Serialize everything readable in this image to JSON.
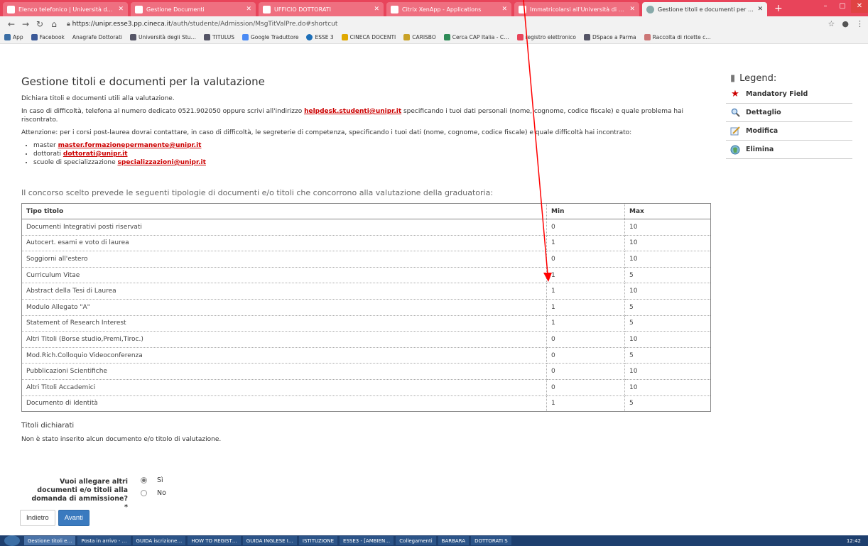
{
  "browser": {
    "tabs": [
      {
        "label": "Elenco telefonico | Università deg…"
      },
      {
        "label": "Gestione Documenti"
      },
      {
        "label": "UFFICIO DOTTORATI"
      },
      {
        "label": "Citrix XenApp - Applications"
      },
      {
        "label": "Immatricolarsi all'Università di Pa…"
      },
      {
        "label": "Gestione titoli e documenti per l…"
      }
    ],
    "url_host": "https://unipr.esse3.pp.cineca.it",
    "url_path": "/auth/studente/Admission/MsgTitValPre.do#shortcut",
    "bookmarks": [
      {
        "label": "App"
      },
      {
        "label": "Facebook"
      },
      {
        "label": "Anagrafe Dottorati"
      },
      {
        "label": "Università degli Stu…"
      },
      {
        "label": "TITULUS"
      },
      {
        "label": "Google Traduttore"
      },
      {
        "label": "ESSE 3"
      },
      {
        "label": "CINECA DOCENTI"
      },
      {
        "label": "CARISBO"
      },
      {
        "label": "Cerca CAP Italia - C…"
      },
      {
        "label": "registro elettronico"
      },
      {
        "label": "DSpace a Parma"
      },
      {
        "label": "Raccolta di ricette c…"
      }
    ]
  },
  "page": {
    "title": "Gestione titoli e documenti per la valutazione",
    "intro": "Dichiara titoli e documenti utili alla valutazione.",
    "help_pre": "In caso di difficoltà, telefona al numero dedicato 0521.902050 oppure scrivi all'indirizzo ",
    "help_email": "helpdesk.studenti@unipr.it",
    "help_post": " specificando i tuoi dati personali (nome, cognome, codice fiscale) e quale problema hai riscontrato.",
    "attention": "Attenzione: per i corsi post-laurea dovrai contattare, in caso di difficoltà, le segreterie di competenza, specificando i tuoi dati (nome, cognome, codice fiscale) e quale difficoltà hai incontrato:",
    "contacts": [
      {
        "label": "master ",
        "email": "master.formazionepermanente@unipr.it"
      },
      {
        "label": "dottorati ",
        "email": "dottorati@unipr.it"
      },
      {
        "label": "scuole di specializzazione ",
        "email": "specializzazioni@unipr.it"
      }
    ],
    "concorso_text": "Il concorso scelto prevede le seguenti tipologie di documenti e/o titoli che concorrono alla valutazione della graduatoria:",
    "table": {
      "headers": [
        "Tipo titolo",
        "Min",
        "Max"
      ],
      "rows": [
        [
          "Documenti Integrativi posti riservati",
          "0",
          "10"
        ],
        [
          "Autocert. esami e voto di laurea",
          "1",
          "10"
        ],
        [
          "Soggiorni all'estero",
          "0",
          "10"
        ],
        [
          "Curriculum Vitae",
          "1",
          "5"
        ],
        [
          "Abstract della Tesi di Laurea",
          "1",
          "10"
        ],
        [
          "Modulo Allegato \"A\"",
          "1",
          "5"
        ],
        [
          "Statement of Research Interest",
          "1",
          "5"
        ],
        [
          "Altri Titoli (Borse studio,Premi,Tiroc.)",
          "0",
          "10"
        ],
        [
          "Mod.Rich.Colloquio Videoconferenza",
          "0",
          "5"
        ],
        [
          "Pubblicazioni Scientifiche",
          "0",
          "10"
        ],
        [
          "Altri Titoli Accademici",
          "0",
          "10"
        ],
        [
          "Documento di Identità",
          "1",
          "5"
        ]
      ]
    },
    "declared_title": "Titoli dichiarati",
    "declared_empty": "Non è stato inserito alcun documento e/o titolo di valutazione.",
    "question": "Vuoi allegare altri documenti e/o titoli alla domanda di ammissione?*",
    "options": [
      {
        "label": "Sì",
        "selected": true
      },
      {
        "label": "No",
        "selected": false
      }
    ],
    "back_label": "Indietro",
    "next_label": "Avanti"
  },
  "legend": {
    "title": "Legend:",
    "items": [
      {
        "label": "Mandatory Field",
        "icon": "star-icon"
      },
      {
        "label": "Dettaglio",
        "icon": "magnifier-icon"
      },
      {
        "label": "Modifica",
        "icon": "edit-icon"
      },
      {
        "label": "Elimina",
        "icon": "delete-icon"
      }
    ]
  },
  "taskbar": {
    "items": [
      {
        "label": "Gestione titoli e…"
      },
      {
        "label": "Posta in arrivo - …"
      },
      {
        "label": "GUIDA iscrizione…"
      },
      {
        "label": "HOW TO REGIST…"
      },
      {
        "label": "GUIDA INGLESE I…"
      },
      {
        "label": "ISTITUZIONE"
      },
      {
        "label": "ESSE3 - [AMBIEN…"
      },
      {
        "label": "Collegamenti"
      },
      {
        "label": "BARBARA"
      },
      {
        "label": "DOTTORATI S"
      }
    ],
    "clock": "12:42"
  },
  "colors": {
    "accent": "#e8445a",
    "link": "#cc0000",
    "primary_button": "#3a7abf",
    "annotation_arrow": "#ff0000"
  }
}
